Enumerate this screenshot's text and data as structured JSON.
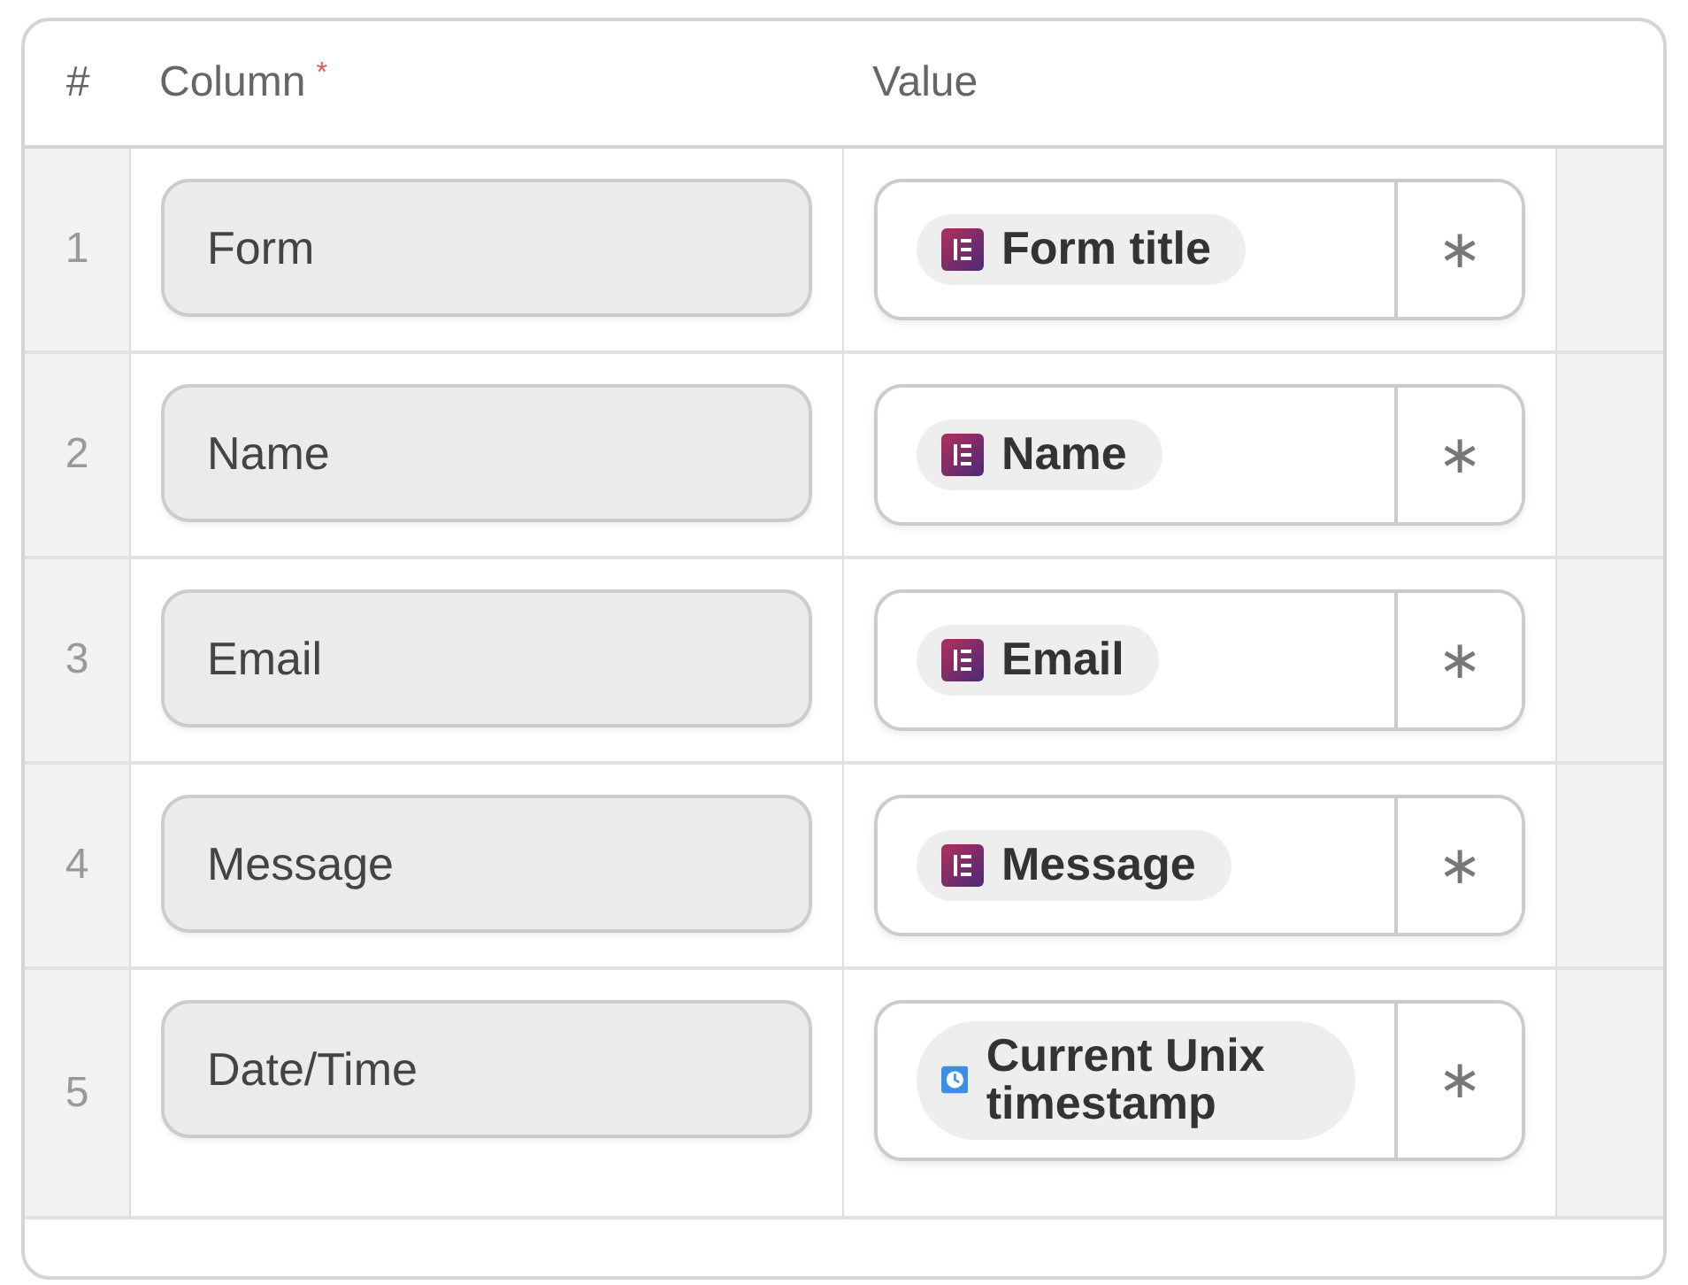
{
  "table": {
    "columns": [
      {
        "label": "#"
      },
      {
        "label": "Column",
        "required_mark": "*"
      },
      {
        "label": "Value"
      }
    ],
    "rows": [
      {
        "number": "1",
        "column": "Form",
        "value": {
          "kind": "form-field",
          "text": "Form title"
        },
        "action": "∗"
      },
      {
        "number": "2",
        "column": "Name",
        "value": {
          "kind": "form-field",
          "text": "Name"
        },
        "action": "∗"
      },
      {
        "number": "3",
        "column": "Email",
        "value": {
          "kind": "form-field",
          "text": "Email"
        },
        "action": "∗"
      },
      {
        "number": "4",
        "column": "Message",
        "value": {
          "kind": "form-field",
          "text": "Message"
        },
        "action": "∗"
      },
      {
        "number": "5",
        "column": "Date/Time",
        "value": {
          "kind": "clock",
          "text": "Current Unix timestamp"
        },
        "action": "∗"
      }
    ]
  }
}
